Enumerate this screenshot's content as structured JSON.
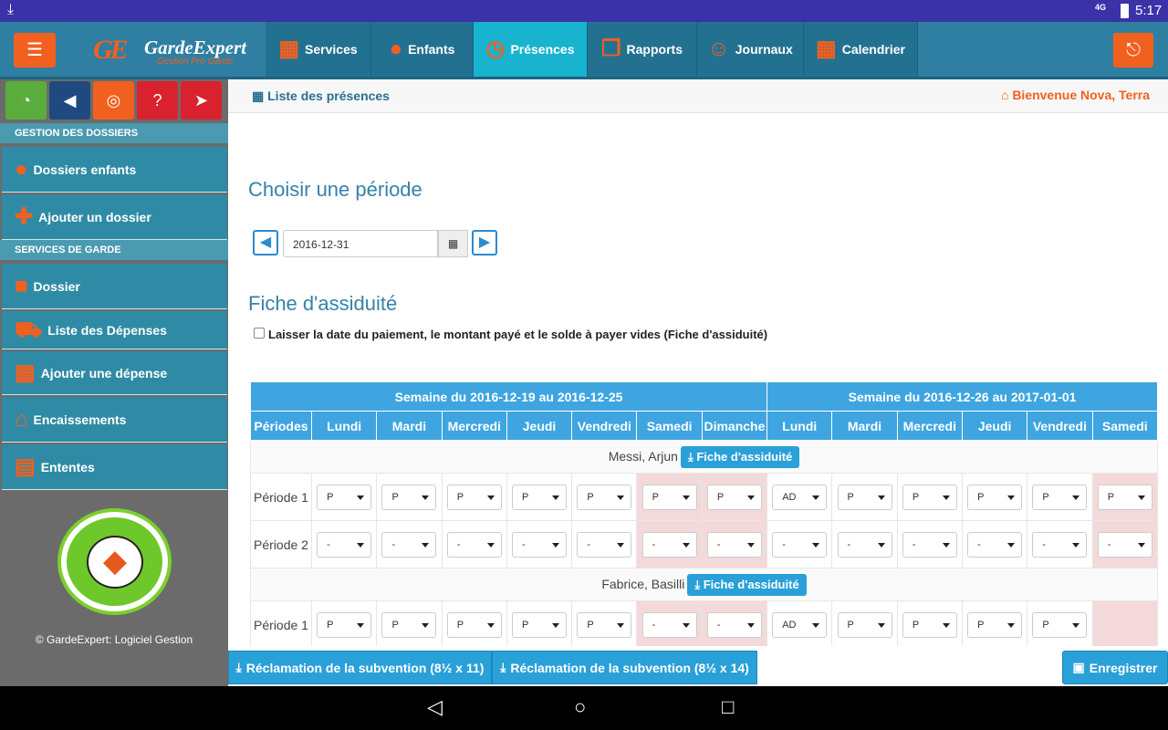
{
  "status_bar": {
    "download_icon": "download-icon",
    "network": "4G",
    "time": "5:17"
  },
  "top_nav": {
    "logo_mark": "GE",
    "logo_name": "GardeExpert",
    "logo_tagline": "Gestion Pro Garde",
    "tabs": [
      {
        "label": "Services",
        "icon": "calculator-icon",
        "active": false
      },
      {
        "label": "Enfants",
        "icon": "users-icon",
        "active": false
      },
      {
        "label": "Présences",
        "icon": "clock-icon",
        "active": true
      },
      {
        "label": "Rapports",
        "icon": "copy-icon",
        "active": false
      },
      {
        "label": "Journaux",
        "icon": "smile-icon",
        "active": false
      },
      {
        "label": "Calendrier",
        "icon": "calendar-icon",
        "active": false
      }
    ]
  },
  "sidebar": {
    "quick_buttons": [
      {
        "icon": "dashboard-icon",
        "color": "#5aad3d"
      },
      {
        "icon": "megaphone-icon",
        "color": "#1e4a7f"
      },
      {
        "icon": "lifebuoy-icon",
        "color": "#f2601f"
      },
      {
        "icon": "help-icon",
        "color": "#d9222d"
      },
      {
        "icon": "send-icon",
        "color": "#d9222d"
      }
    ],
    "section_dossiers": "GESTION DES DOSSIERS",
    "section_services": "SERVICES DE GARDE",
    "items": [
      {
        "label": "Dossiers enfants",
        "icon": "users-icon"
      },
      {
        "label": "Ajouter un dossier",
        "icon": "add-child-icon"
      },
      {
        "label": "Dossier",
        "icon": "folder-icon"
      },
      {
        "label": "Liste des Dépenses",
        "icon": "cart-icon"
      },
      {
        "label": "Ajouter une dépense",
        "icon": "calculator-icon"
      },
      {
        "label": "Encaissements",
        "icon": "bank-icon"
      },
      {
        "label": "Ententes",
        "icon": "document-icon"
      }
    ],
    "copyright": "© GardeExpert: Logiciel Gestion"
  },
  "page": {
    "breadcrumb": "Liste des présences",
    "welcome": "Bienvenue Nova, Terra",
    "period_title": "Choisir une période",
    "date_value": "2016-12-31",
    "attendance_title": "Fiche d'assiduité",
    "checkbox_label": "Laisser la date du paiement, le montant payé et le solde à payer vides (Fiche d'assiduité)"
  },
  "grid": {
    "week1": "Semaine du 2016-12-19 au 2016-12-25",
    "week2": "Semaine du 2016-12-26 au 2017-01-01",
    "col_periodes": "Périodes",
    "days": [
      "Lundi",
      "Mardi",
      "Mercredi",
      "Jeudi",
      "Vendredi",
      "Samedi",
      "Dimanche",
      "Lundi",
      "Mardi",
      "Mercredi",
      "Jeudi",
      "Vendredi",
      "Samedi"
    ],
    "fiche_label": "Fiche d'assiduité",
    "children": [
      {
        "name": "Messi, Arjun",
        "periods": [
          {
            "label": "Période 1",
            "values": [
              "P",
              "P",
              "P",
              "P",
              "P",
              "P",
              "P",
              "AD",
              "P",
              "P",
              "P",
              "P",
              "P"
            ]
          },
          {
            "label": "Période 2",
            "values": [
              "-",
              "-",
              "-",
              "-",
              "-",
              "-",
              "-",
              "-",
              "-",
              "-",
              "-",
              "-",
              "-"
            ]
          }
        ]
      },
      {
        "name": "Fabrice, Basilli",
        "periods": [
          {
            "label": "Période 1",
            "values": [
              "P",
              "P",
              "P",
              "P",
              "P",
              "-",
              "-",
              "AD",
              "P",
              "P",
              "P",
              "P",
              ""
            ]
          }
        ]
      }
    ]
  },
  "bottom_bar": {
    "btn_11": "Réclamation de la subvention (8½ x 11)",
    "btn_14": "Réclamation de la subvention (8½ x 14)",
    "save": "Enregistrer"
  }
}
